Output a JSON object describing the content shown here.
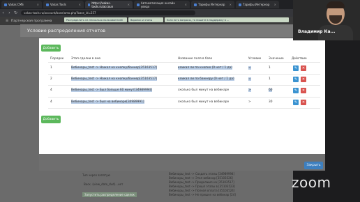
{
  "browser": {
    "tabs": [
      {
        "label": "Vakas CMS"
      },
      {
        "label": "Vakas Tools"
      },
      {
        "label": "https://vakas-tools.ru/accoun"
      },
      {
        "label": "Автоматизация онлайн уведо"
      },
      {
        "label": "Тарифы Интернар"
      },
      {
        "label": "Тарифы Интернар"
      }
    ],
    "url": "vakas-tools.ru/account/base/amo.php?base_id=257"
  },
  "app": {
    "nav_label": "Партнерская программа",
    "notices": [
      "Распределить на несколько пользователей",
      "Воронки и этапы",
      "Если есть вопросы, то пишите в поддержку в ..."
    ]
  },
  "modal": {
    "title": "Условие распределения отчетов",
    "add_label": "Добавить",
    "headers": [
      "Порядок",
      "Этап сделки в амо",
      "Название поля в базе",
      "Условие",
      "Значение",
      "Действие"
    ],
    "rows": [
      {
        "order": "1",
        "stage": "Вебинары_test -> Нажал на кнопку/баннер[35103517]",
        "field": "кликал ли по кнопке (0 нет / 1 да)",
        "condition": "=",
        "value": "1"
      },
      {
        "order": "2",
        "stage": "Вебинары_test -> Нажал на кнопку/баннер[35103517]",
        "field": "кликал ли по баннеру (0 нет / 1 да)",
        "condition": "=",
        "value": "1"
      },
      {
        "order": "4",
        "stage": "Вебинары_test -> Был больше 60 минут[34989994]",
        "field": "сколько был минут на вебинаре",
        "condition": ">",
        "value": "60"
      },
      {
        "order": "4",
        "stage": "Вебинары_test -> был на вебинаре[34989991]",
        "field": "сколько был минут на вебинаре",
        "condition": ">",
        "value": "30"
      }
    ],
    "add_label_bottom": "Добавить",
    "close_label": "Закрыть"
  },
  "background": {
    "left_lines": [
      "Тип через запятую",
      "Воск. (view_date_dvd)...нет"
    ],
    "button_label": "Запустить распределение сделок",
    "right_lines": [
      "Вебинары_test -> Создать этапы [34989994]",
      "Вебинары_test -> Этап вебинар [35103526]",
      "Вебинары_test -> Продолжил на [35103517]",
      "Вебинары_test -> Прошл этапы в [35103523]",
      "Вебинары_test -> Полная оплата [35103524]",
      "Вебинары_test -> Не пришел на вебинар [24]"
    ]
  },
  "video": {
    "participant_name": "Владимир Ка...",
    "brand": "zoom"
  }
}
